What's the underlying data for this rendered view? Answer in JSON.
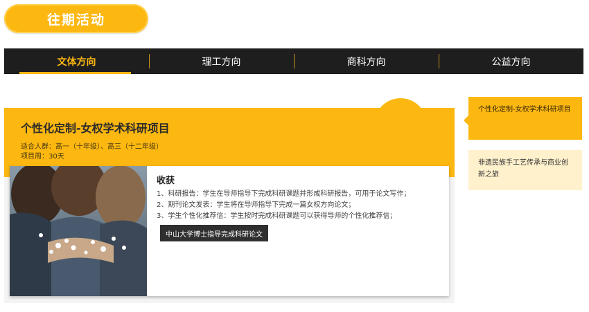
{
  "header": {
    "title": "往期活动"
  },
  "tabs": [
    {
      "label": "文体方向",
      "active": true
    },
    {
      "label": "理工方向",
      "active": false
    },
    {
      "label": "商科方向",
      "active": false
    },
    {
      "label": "公益方向",
      "active": false
    }
  ],
  "project": {
    "title": "个性化定制-女权学术科研项目",
    "audience": "适合人群：高一（十年级）、高三（十二年级）",
    "duration": "项目周：30天",
    "photo_icon": "group-photo-icon",
    "gains_heading": "收获",
    "gains": [
      "1、科研报告：学生在导师指导下完成科研课题并形成科研报告，可用于论文写作；",
      "2、期刊论文发表：学生将在导师指导下完成一篇女权方向论文；",
      "3、学生个性化推荐信：学生按时完成科研课题可以获得导师的个性化推荐信；"
    ],
    "tag_label": "中山大学博士指导完成科研论文"
  },
  "sidebar": {
    "items": [
      {
        "label": "个性化定制-女权学术科研项目",
        "active": true
      },
      {
        "label": "非遗民族手工艺传承与商业创新之旅",
        "active": false
      }
    ]
  },
  "colors": {
    "accent": "#fcb711",
    "dark": "#1e1e1e",
    "light_accent": "#fff1cc"
  }
}
